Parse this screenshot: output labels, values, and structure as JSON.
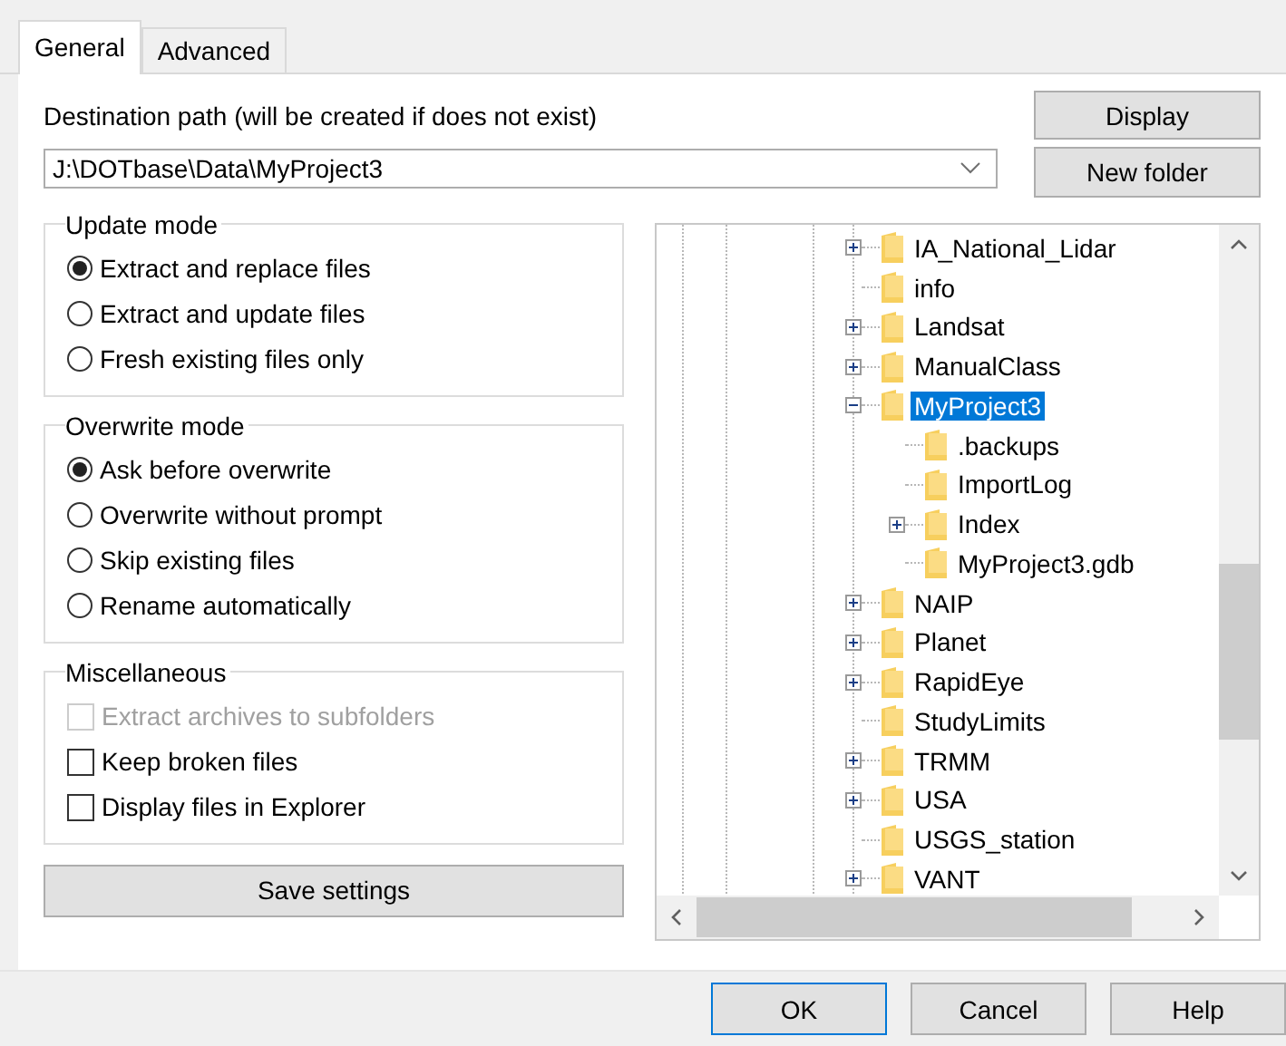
{
  "tabs": [
    {
      "label": "General",
      "selected": true
    },
    {
      "label": "Advanced",
      "selected": false
    }
  ],
  "destination": {
    "label": "Destination path (will be created if does not exist)",
    "value": "J:\\DOTbase\\Data\\MyProject3"
  },
  "side_buttons": [
    "Display",
    "New folder"
  ],
  "update_mode": {
    "title": "Update mode",
    "options": [
      {
        "label": "Extract and replace files",
        "selected": true
      },
      {
        "label": "Extract and update files",
        "selected": false
      },
      {
        "label": "Fresh existing files only",
        "selected": false
      }
    ]
  },
  "overwrite_mode": {
    "title": "Overwrite mode",
    "options": [
      {
        "label": "Ask before overwrite",
        "selected": true
      },
      {
        "label": "Overwrite without prompt",
        "selected": false
      },
      {
        "label": "Skip existing files",
        "selected": false
      },
      {
        "label": "Rename automatically",
        "selected": false
      }
    ]
  },
  "miscellaneous": {
    "title": "Miscellaneous",
    "options": [
      {
        "label": "Extract archives to subfolders",
        "checked": false,
        "disabled": true
      },
      {
        "label": "Keep broken files",
        "checked": false,
        "disabled": false
      },
      {
        "label": "Display files in Explorer",
        "checked": false,
        "disabled": false
      }
    ]
  },
  "save_button": "Save settings",
  "tree": [
    {
      "label": "IA_National_Lidar",
      "kind": "expandable",
      "expanded": false,
      "selected": false
    },
    {
      "label": "info",
      "kind": "leaf",
      "selected": false
    },
    {
      "label": "Landsat",
      "kind": "expandable",
      "expanded": false,
      "selected": false
    },
    {
      "label": "ManualClass",
      "kind": "expandable",
      "expanded": false,
      "selected": false
    },
    {
      "label": "MyProject3",
      "kind": "expandable",
      "expanded": true,
      "selected": true,
      "children": [
        {
          "label": ".backups",
          "kind": "leaf",
          "selected": false
        },
        {
          "label": "ImportLog",
          "kind": "leaf",
          "selected": false
        },
        {
          "label": "Index",
          "kind": "expandable",
          "expanded": false,
          "selected": false
        },
        {
          "label": "MyProject3.gdb",
          "kind": "leaf",
          "selected": false
        }
      ]
    },
    {
      "label": "NAIP",
      "kind": "expandable",
      "expanded": false,
      "selected": false
    },
    {
      "label": "Planet",
      "kind": "expandable",
      "expanded": false,
      "selected": false
    },
    {
      "label": "RapidEye",
      "kind": "expandable",
      "expanded": false,
      "selected": false
    },
    {
      "label": "StudyLimits",
      "kind": "leaf",
      "selected": false
    },
    {
      "label": "TRMM",
      "kind": "expandable",
      "expanded": false,
      "selected": false
    },
    {
      "label": "USA",
      "kind": "expandable",
      "expanded": false,
      "selected": false
    },
    {
      "label": "USGS_station",
      "kind": "leaf",
      "selected": false
    },
    {
      "label": "VANT",
      "kind": "expandable",
      "expanded": false,
      "selected": false
    }
  ],
  "dialog_buttons": [
    {
      "label": "OK",
      "selected": true
    },
    {
      "label": "Cancel",
      "selected": false
    },
    {
      "label": "Help",
      "selected": false
    }
  ]
}
